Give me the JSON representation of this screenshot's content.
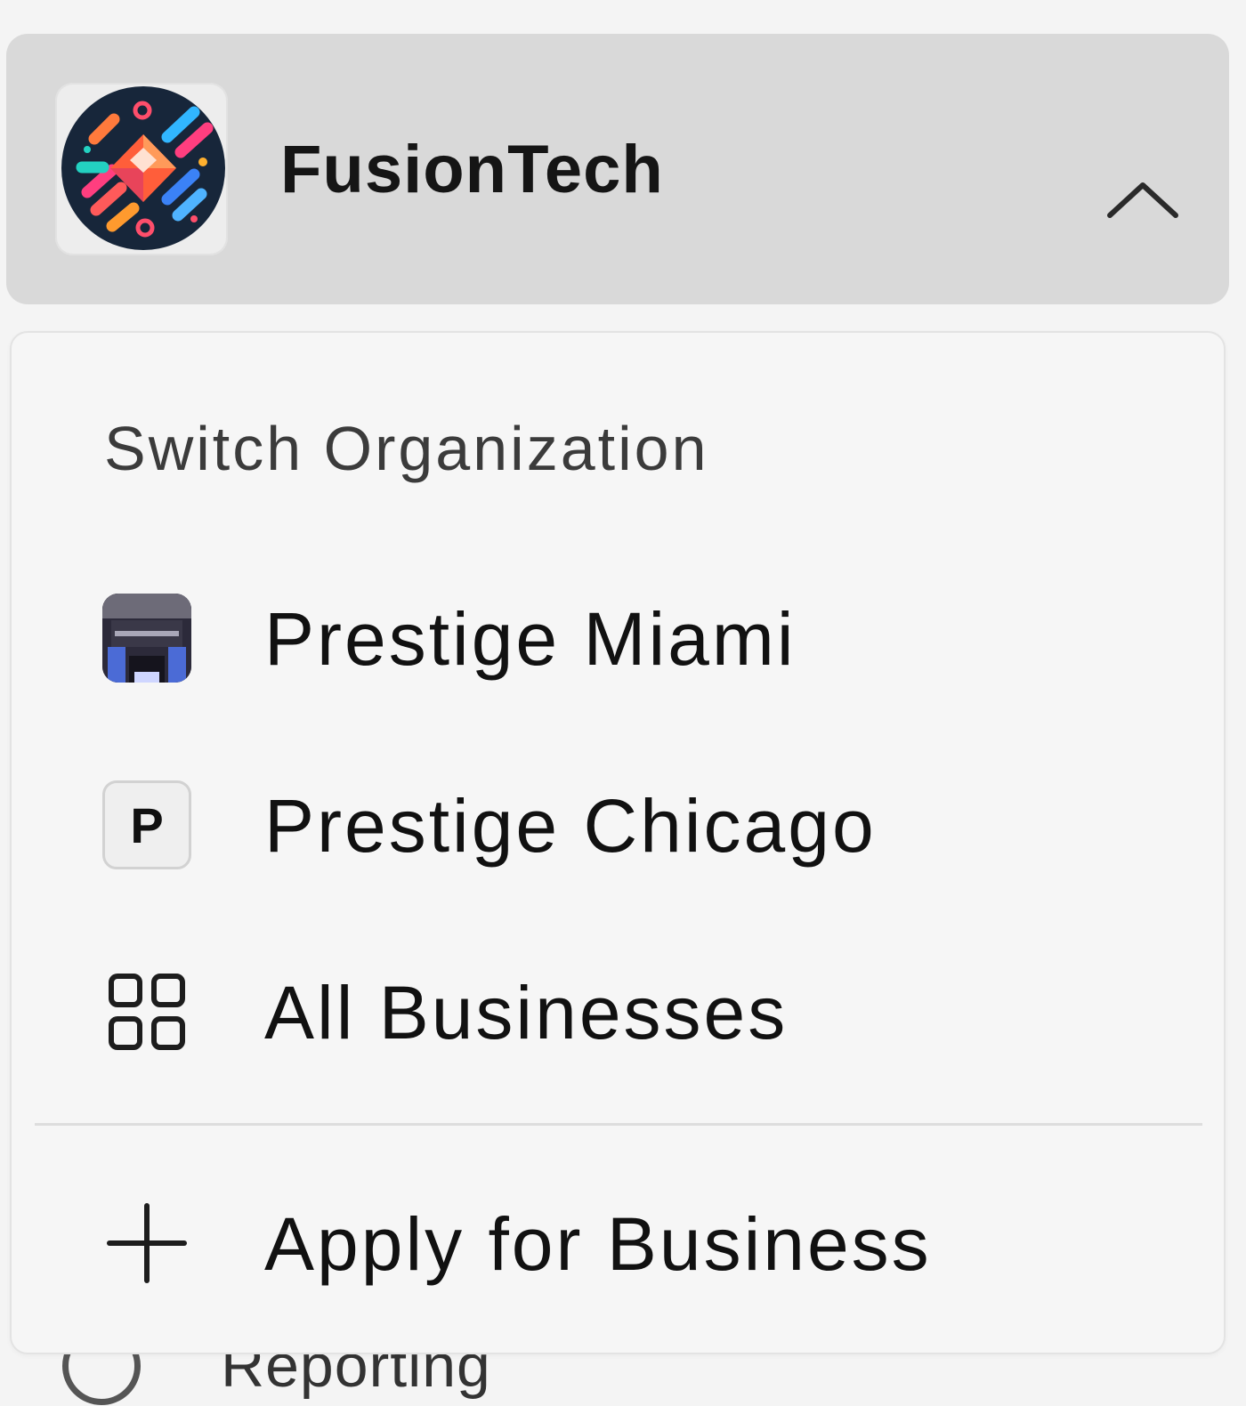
{
  "org_switcher": {
    "current_org_name": "FusionTech",
    "logo_icon": "fusiontech-logo",
    "toggle_icon": "chevron-up-icon"
  },
  "dropdown": {
    "title": "Switch Organization",
    "items": [
      {
        "label": "Prestige Miami",
        "icon": "org-thumbnail"
      },
      {
        "label": "Prestige Chicago",
        "icon": "letter-avatar",
        "avatar_letter": "P"
      },
      {
        "label": "All Businesses",
        "icon": "grid-icon"
      }
    ],
    "apply": {
      "label": "Apply for Business",
      "icon": "plus-icon"
    }
  },
  "background_item": {
    "label": "Reporting",
    "icon": "circle-icon"
  }
}
